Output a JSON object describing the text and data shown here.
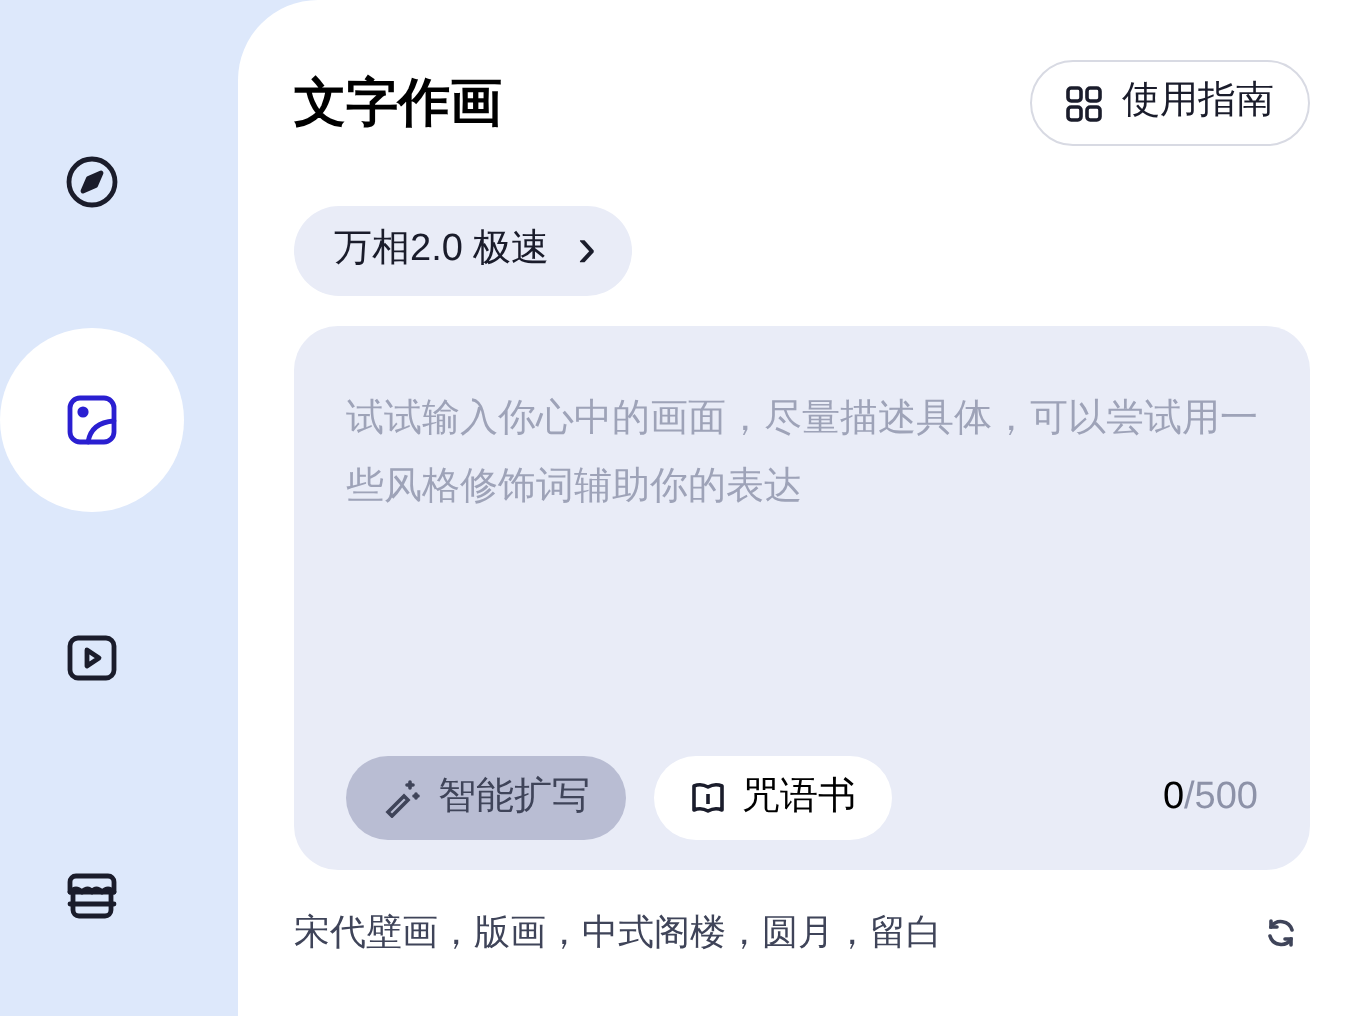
{
  "sidebar": {
    "items": [
      {
        "kind": "compass",
        "selected": false
      },
      {
        "kind": "image",
        "selected": true
      },
      {
        "kind": "play",
        "selected": false
      },
      {
        "kind": "store",
        "selected": false
      }
    ]
  },
  "header": {
    "title": "文字作画",
    "guide_button": "使用指南"
  },
  "model_selector": {
    "label": "万相2.0 极速",
    "chevron": "›"
  },
  "prompt": {
    "placeholder": "试试输入你心中的画面，尽量描述具体，可以尝试用一些风格修饰词辅助你的表达",
    "tools": [
      {
        "kind": "expand",
        "label": "智能扩写"
      },
      {
        "kind": "spellbook",
        "label": "咒语书"
      }
    ],
    "count": "0",
    "limit": "/500"
  },
  "suggestion": {
    "text": "宋代壁画，版画，中式阁楼，圆月，留白"
  }
}
